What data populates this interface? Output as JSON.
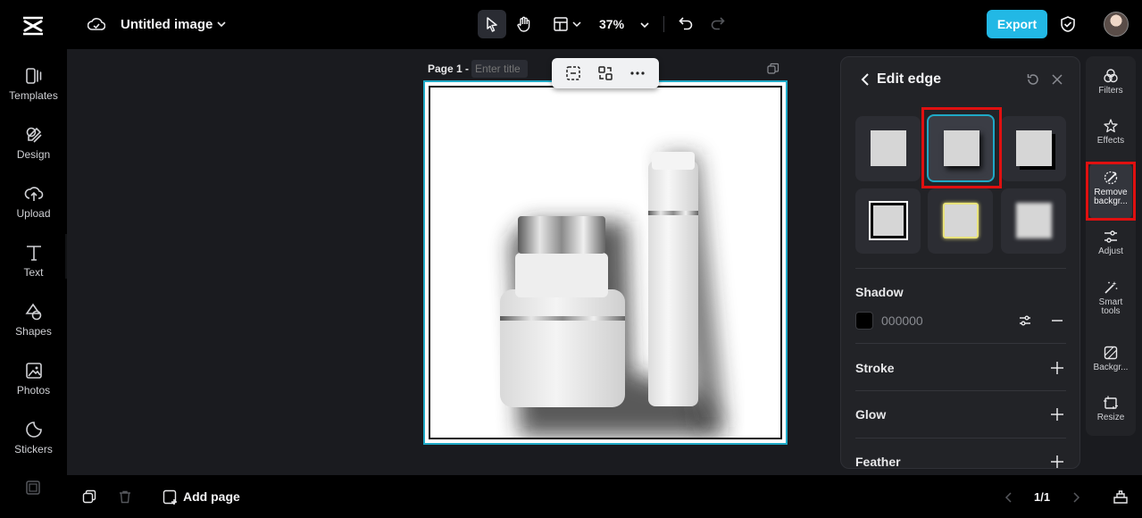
{
  "header": {
    "title": "Untitled image",
    "zoom": "37%",
    "export_label": "Export"
  },
  "left_nav": [
    {
      "label": "Templates",
      "icon": "templates-icon"
    },
    {
      "label": "Design",
      "icon": "design-icon"
    },
    {
      "label": "Upload",
      "icon": "upload-icon"
    },
    {
      "label": "Text",
      "icon": "text-icon"
    },
    {
      "label": "Shapes",
      "icon": "shapes-icon"
    },
    {
      "label": "Photos",
      "icon": "photos-icon"
    },
    {
      "label": "Stickers",
      "icon": "stickers-icon"
    }
  ],
  "canvas": {
    "page_label": "Page 1 -",
    "title_placeholder": "Enter title"
  },
  "edit_edge": {
    "title": "Edit edge",
    "shadow": {
      "label": "Shadow",
      "color_hex": "000000"
    },
    "stroke_label": "Stroke",
    "glow_label": "Glow",
    "feather_label": "Feather"
  },
  "right_tools": [
    {
      "label": "Filters",
      "icon": "filters-icon"
    },
    {
      "label": "Effects",
      "icon": "effects-icon"
    },
    {
      "label": "Remove backgr...",
      "icon": "remove-background-icon"
    },
    {
      "label": "Adjust",
      "icon": "adjust-icon"
    },
    {
      "label": "Smart tools",
      "icon": "smart-tools-icon"
    },
    {
      "label": "Backgr...",
      "icon": "background-icon"
    },
    {
      "label": "Resize",
      "icon": "resize-icon"
    }
  ],
  "footer": {
    "add_page_label": "Add page",
    "page_count": "1/1"
  },
  "colors": {
    "accent": "#22b8e5",
    "selection": "#1fa9c6",
    "highlight": "#e01010"
  }
}
